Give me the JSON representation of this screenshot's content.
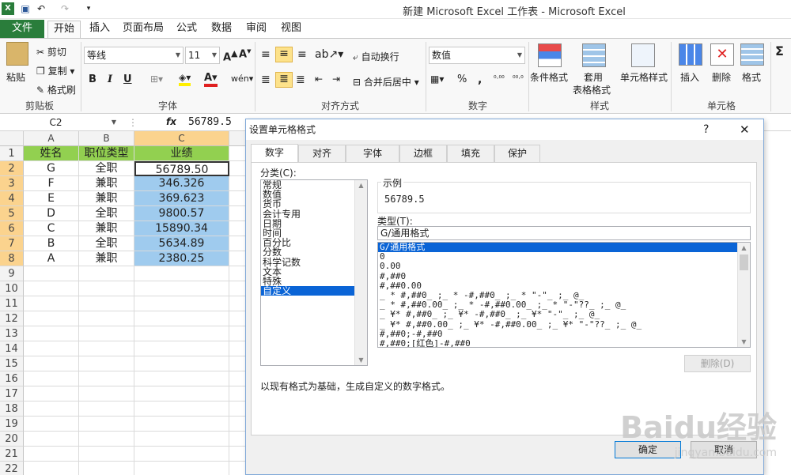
{
  "window": {
    "title": "新建 Microsoft Excel 工作表 - Microsoft Excel"
  },
  "ribbon_tabs": [
    "文件",
    "开始",
    "插入",
    "页面布局",
    "公式",
    "数据",
    "审阅",
    "视图"
  ],
  "clipboard": {
    "paste": "粘贴",
    "cut": "剪切",
    "copy": "复制",
    "format_painter": "格式刷",
    "label": "剪贴板"
  },
  "font": {
    "name": "等线",
    "size": "11",
    "label": "字体",
    "bold": "B",
    "italic": "I",
    "underline": "U"
  },
  "alignment": {
    "wrap": "自动换行",
    "merge": "合并后居中",
    "label": "对齐方式"
  },
  "number": {
    "format": "数值",
    "label": "数字",
    "percent": "%",
    "comma": ","
  },
  "styles": {
    "conditional": "条件格式",
    "table": "套用",
    "table2": "表格格式",
    "cell": "单元格样式",
    "label": "样式"
  },
  "cells": {
    "insert": "插入",
    "delete": "删除",
    "format": "格式",
    "label": "单元格"
  },
  "formula_bar": {
    "name_box": "C2",
    "fx": "fx",
    "value": "56789.5"
  },
  "sheet": {
    "columns": [
      "A",
      "B",
      "C"
    ],
    "rows": [
      {
        "num": "1",
        "cells": [
          "姓名",
          "职位类型",
          "业绩"
        ]
      },
      {
        "num": "2",
        "cells": [
          "G",
          "全职",
          "56789.50"
        ]
      },
      {
        "num": "3",
        "cells": [
          "F",
          "兼职",
          "346.326"
        ]
      },
      {
        "num": "4",
        "cells": [
          "E",
          "兼职",
          "369.623"
        ]
      },
      {
        "num": "5",
        "cells": [
          "D",
          "全职",
          "9800.57"
        ]
      },
      {
        "num": "6",
        "cells": [
          "C",
          "兼职",
          "15890.34"
        ]
      },
      {
        "num": "7",
        "cells": [
          "B",
          "全职",
          "5634.89"
        ]
      },
      {
        "num": "8",
        "cells": [
          "A",
          "兼职",
          "2380.25"
        ]
      }
    ],
    "empty_rows": [
      "9",
      "10",
      "11",
      "12",
      "13",
      "14",
      "15",
      "16",
      "17",
      "18",
      "19",
      "20",
      "21",
      "22"
    ]
  },
  "dialog": {
    "title": "设置单元格格式",
    "help": "?",
    "close": "✕",
    "tabs": [
      "数字",
      "对齐",
      "字体",
      "边框",
      "填充",
      "保护"
    ],
    "category_label": "分类(C):",
    "categories": [
      "常规",
      "数值",
      "货币",
      "会计专用",
      "日期",
      "时间",
      "百分比",
      "分数",
      "科学记数",
      "文本",
      "特殊",
      "自定义"
    ],
    "sample_label": "示例",
    "sample_value": "56789.5",
    "type_label": "类型(T):",
    "type_value": "G/通用格式",
    "types": [
      "G/通用格式",
      "0",
      "0.00",
      "#,##0",
      "#,##0.00",
      "_ * #,##0_ ;_ * -#,##0_ ;_ * \"-\"_ ;_ @_",
      "_ * #,##0.00_ ;_ * -#,##0.00_ ;_ * \"-\"??_ ;_ @_",
      "_ ¥* #,##0_ ;_ ¥* -#,##0_ ;_ ¥* \"-\"_ ;_ @_",
      "_ ¥* #,##0.00_ ;_ ¥* -#,##0.00_ ;_ ¥* \"-\"??_ ;_ @_",
      "#,##0;-#,##0",
      "#,##0;[红色]-#,##0"
    ],
    "delete_button": "删除(D)",
    "description": "以现有格式为基础，生成自定义的数字格式。",
    "ok_button": "确定",
    "cancel_button": "取消"
  },
  "watermark": "Baidu经验",
  "watermark_url": "jingyan.baidu.com"
}
